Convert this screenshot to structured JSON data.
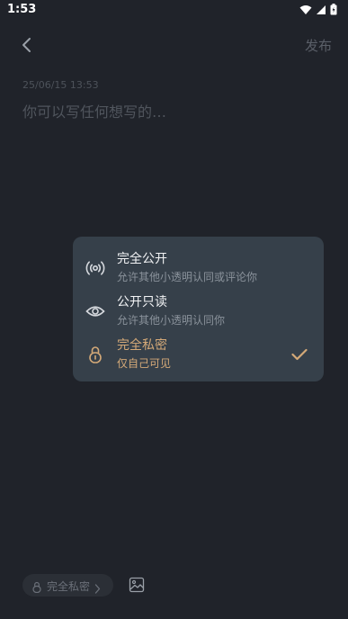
{
  "status_bar": {
    "time": "1:53",
    "icons": [
      "wifi-icon",
      "signal-icon",
      "battery-icon"
    ]
  },
  "header": {
    "back_icon": "chevron-left-icon",
    "publish_label": "发布"
  },
  "note": {
    "timestamp": "25/06/15 13:53",
    "placeholder": "你可以写任何想写的…"
  },
  "privacy_menu": {
    "items": [
      {
        "icon": "broadcast-icon",
        "title": "完全公开",
        "description": "允许其他小透明认同或评论你",
        "selected": false
      },
      {
        "icon": "eye-icon",
        "title": "公开只读",
        "description": "允许其他小透明认同你",
        "selected": false
      },
      {
        "icon": "lock-icon",
        "title": "完全私密",
        "description": "仅自己可见",
        "selected": true
      }
    ],
    "check_icon": "checkmark-icon"
  },
  "toolbar": {
    "privacy_chip_label": "完全私密",
    "image_icon": "image-icon"
  },
  "colors": {
    "background": "#20232a",
    "menu_background": "#36404a",
    "accent": "#d4a978",
    "muted_text": "#50555d"
  }
}
